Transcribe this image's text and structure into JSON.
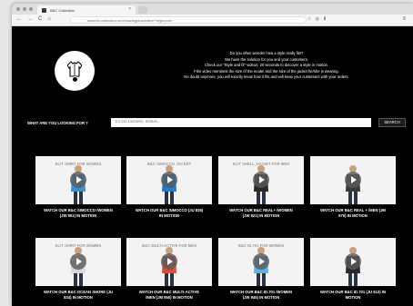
{
  "browser": {
    "tab_title": "B&C Collection",
    "url": "www.bc-collection.eu/en/sizingplus/index/?region=en",
    "nav": {
      "back": "←",
      "forward": "→",
      "reload": "C",
      "home": "⌂"
    }
  },
  "intro": {
    "lines": [
      "Do you often wonder how a style really fits?",
      "We have the solution for you and your customers.",
      "Check our \"Style and fit\" videos: 20 seconds to discover a style in motion.",
      "Film video mentions the size of the model and the size of the jacket he/she is wearing.",
      "No doubt anymore, you will exactly know how it fits and will keep your customers with your orders."
    ]
  },
  "search": {
    "label": "WHAT ARE YOU LOOKING FOR ?",
    "placeholder": "Ex:ID.Fairness, bodies...",
    "button": "SEARCH"
  },
  "videos": [
    {
      "bg": "ELIT SHIRT FOR WOMEN",
      "line1": "WATCH OUR B&C SIMOCCO /WOMEN",
      "line2": "(JW 901) IN MOTION",
      "shirt": "#3b8fd6"
    },
    {
      "bg": "B&C SIMOCCO JACKET",
      "line1": "WATCH OUR B&C SIMOCCO (JU 835)",
      "line2": "IN MOTION",
      "shirt": "#1f7ed0"
    },
    {
      "bg": "ELIT SHELL JACKET FOR MEN",
      "line1": "WATCH OUR B&C REAL+ /WOMEN",
      "line2": "(JW 921) IN MOTION",
      "shirt": "#2a2a2a"
    },
    {
      "bg": "",
      "line1": "WATCH OUR B&C REAL + /MEN (JM",
      "line2": "970) IN MOTION",
      "shirt": "#3a3a3a"
    },
    {
      "bg": "ELIT SHIRT FOR WOMEN",
      "line1": "WATCH OUR B&C OCEAN SHORE (JU",
      "line2": "834) IN MOTION",
      "shirt": "#d8d8d8"
    },
    {
      "bg": "B&C MULTI-ACTIVE FOR MEN",
      "line1": "WATCH OUR B&C MULTI-ACTIVE",
      "line2": "/MEN (JM 950) IN MOTION",
      "shirt": "#e14a3b"
    },
    {
      "bg": "B&C ID.701 FOR WOMEN",
      "line1": "WATCH OUR B&C ID.701 /WOMEN",
      "line2": "(JW 945) IN MOTION",
      "shirt": "#5fb3e3"
    },
    {
      "bg": "",
      "line1": "WATCH OUR B&C ID.701 (JU 612) IN",
      "line2": "MOTION",
      "shirt": "#2b2b2b"
    }
  ]
}
